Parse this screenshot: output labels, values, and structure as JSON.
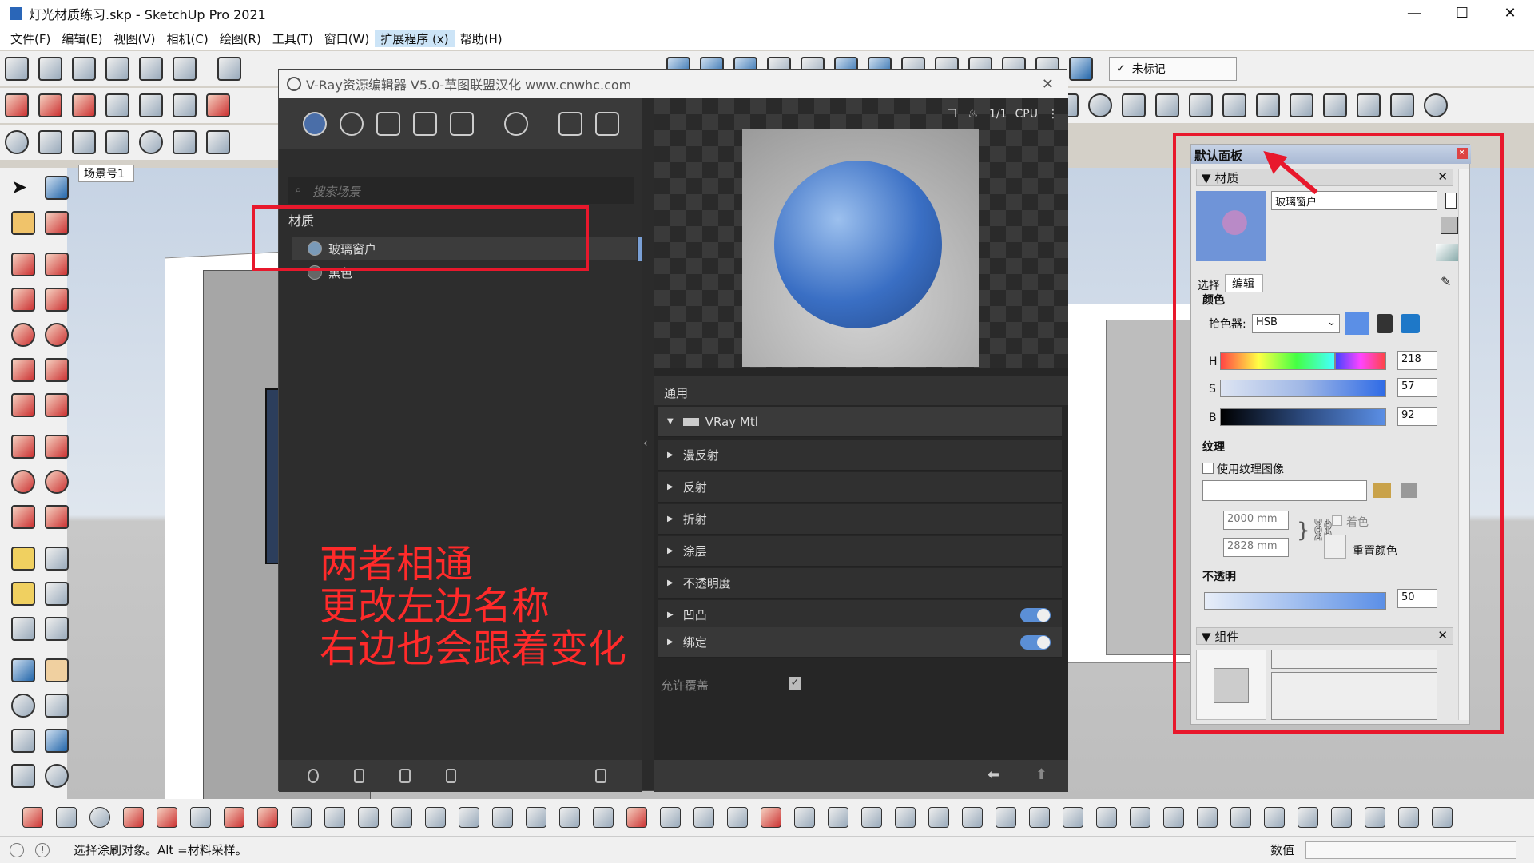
{
  "app": {
    "title": "灯光材质练习.skp - SketchUp Pro 2021",
    "window_controls": [
      "—",
      "☐",
      "✕"
    ]
  },
  "menu": [
    "文件(F)",
    "编辑(E)",
    "视图(V)",
    "相机(C)",
    "绘图(R)",
    "工具(T)",
    "窗口(W)",
    "扩展程序 (x)",
    "帮助(H)"
  ],
  "tag_dropdown": "未标记",
  "scene_tab": "场景号1",
  "vray": {
    "title": "V-Ray资源编辑器 V5.0-草图联盟汉化 www.cnwhc.com",
    "search_placeholder": "搜索场景",
    "section": "材质",
    "materials": [
      "玻璃窗户",
      "黑色"
    ],
    "preview_bar": {
      "res": "1/1",
      "engine": "CPU"
    },
    "general_label": "通用",
    "mtl_type": "VRay Mtl",
    "layers": [
      "漫反射",
      "反射",
      "折射",
      "涂层",
      "不透明度",
      "凹凸",
      "绑定"
    ],
    "allow_override": "允许覆盖"
  },
  "annotation": [
    "两者相通",
    "更改左边名称",
    "右边也会跟着变化"
  ],
  "tray": {
    "title": "默认面板",
    "materials_label": "材质",
    "material_name": "玻璃窗户",
    "tabs": [
      "选择",
      "编辑"
    ],
    "color_label": "颜色",
    "picker_label": "拾色器:",
    "picker_value": "HSB",
    "h": {
      "label": "H",
      "value": "218"
    },
    "s": {
      "label": "S",
      "value": "57"
    },
    "b": {
      "label": "B",
      "value": "92"
    },
    "texture_label": "纹理",
    "use_texture": "使用纹理图像",
    "width": "2000 mm",
    "height": "2828 mm",
    "colorize": "着色",
    "reset_color": "重置颜色",
    "opacity_label": "不透明",
    "opacity_value": "50",
    "components_label": "组件",
    "color_hex": "#5b8fe6"
  },
  "status": {
    "text": "选择涂刷对象。Alt =材料采样。",
    "value_label": "数值"
  },
  "colors": {
    "accent_red": "#e8182c",
    "annotation_red": "#ff2a2a"
  }
}
